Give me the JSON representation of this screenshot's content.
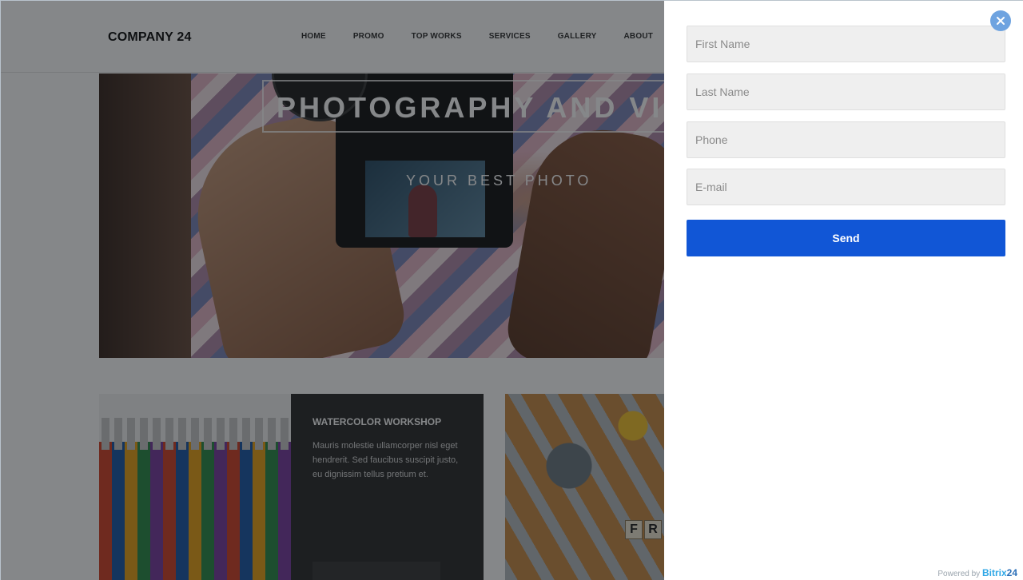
{
  "site": {
    "logo": "COMPANY 24",
    "nav": [
      "HOME",
      "PROMO",
      "TOP WORKS",
      "SERVICES",
      "GALLERY",
      "ABOUT"
    ],
    "hero": {
      "title": "PHOTOGRAPHY AND VID",
      "subtitle": "YOUR BEST PHOTO"
    },
    "card": {
      "title": "WATERCOLOR WORKSHOP",
      "text": "Mauris molestie ullamcorper nisl eget hendrerit. Sed faucibus suscipit justo, eu dignissim tellus pretium et."
    },
    "tiles": [
      "F",
      "R"
    ]
  },
  "form": {
    "first_name_placeholder": "First Name",
    "last_name_placeholder": "Last Name",
    "phone_placeholder": "Phone",
    "email_placeholder": "E-mail",
    "send_label": "Send",
    "powered_prefix": "Powered by",
    "powered_brand": "Bitrix",
    "powered_number": "24"
  },
  "icons": {
    "close": "close-icon"
  },
  "colors": {
    "accent": "#1156d6",
    "close_button": "#6ea3e0",
    "field_bg": "#efefef",
    "brand": "#2fa7e6"
  }
}
